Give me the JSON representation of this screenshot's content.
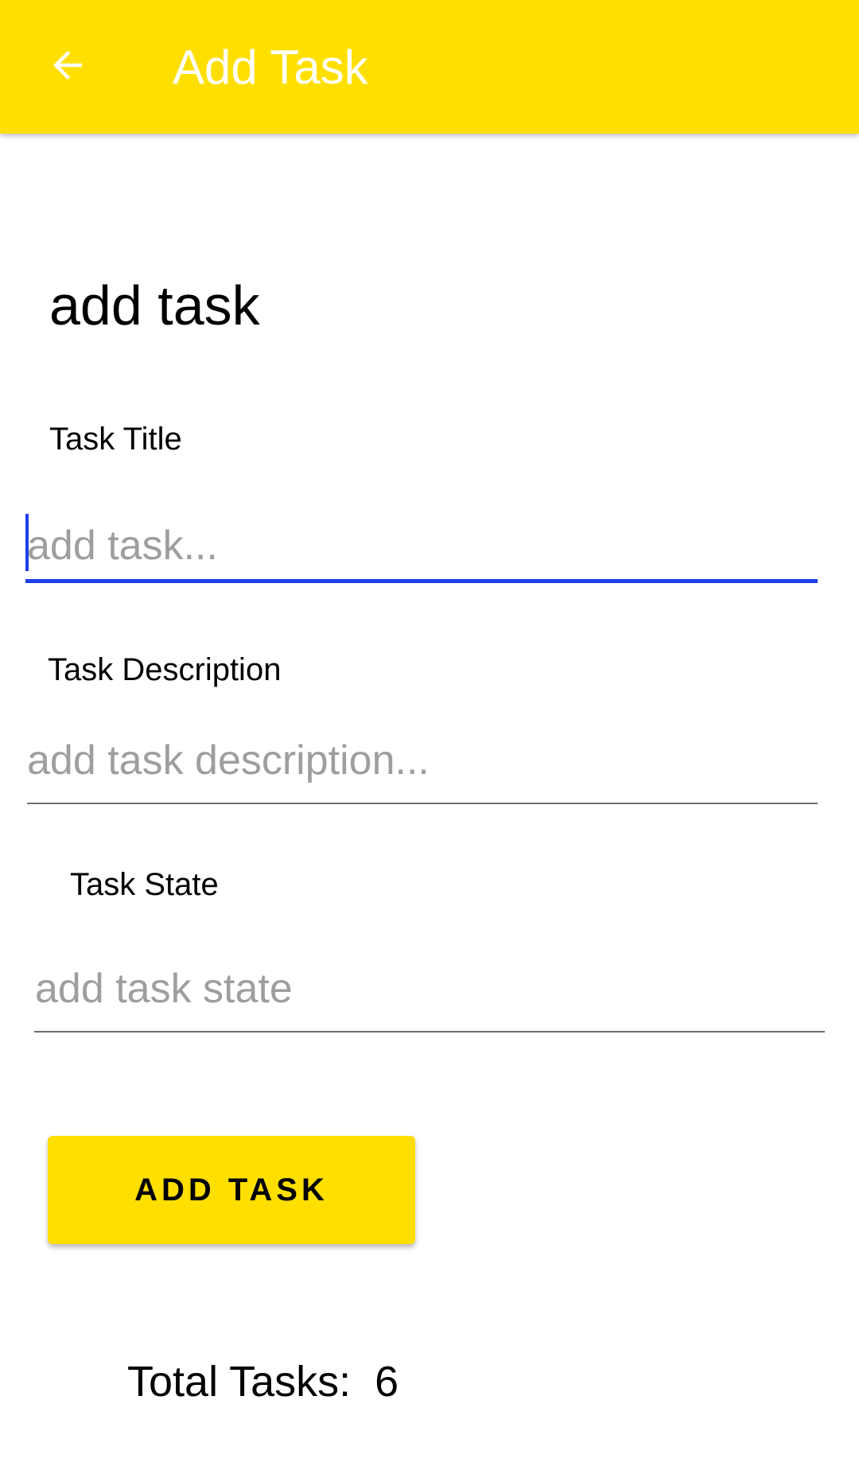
{
  "app_bar": {
    "title": "Add Task",
    "back_icon": "arrow-left-icon",
    "background_color": "#FFDF00",
    "title_color": "#FFFFFF"
  },
  "form": {
    "heading": "add task",
    "title_field": {
      "label": "Task Title",
      "placeholder": "add task...",
      "value": "",
      "focused": true
    },
    "description_field": {
      "label": "Task Description",
      "placeholder": "add task description...",
      "value": ""
    },
    "state_field": {
      "label": "Task State",
      "placeholder": "add task state",
      "value": ""
    },
    "submit_label": "ADD TASK",
    "accent_color": "#1E3FE8"
  },
  "summary": {
    "total_label": "Total Tasks:",
    "total_count": "6"
  }
}
